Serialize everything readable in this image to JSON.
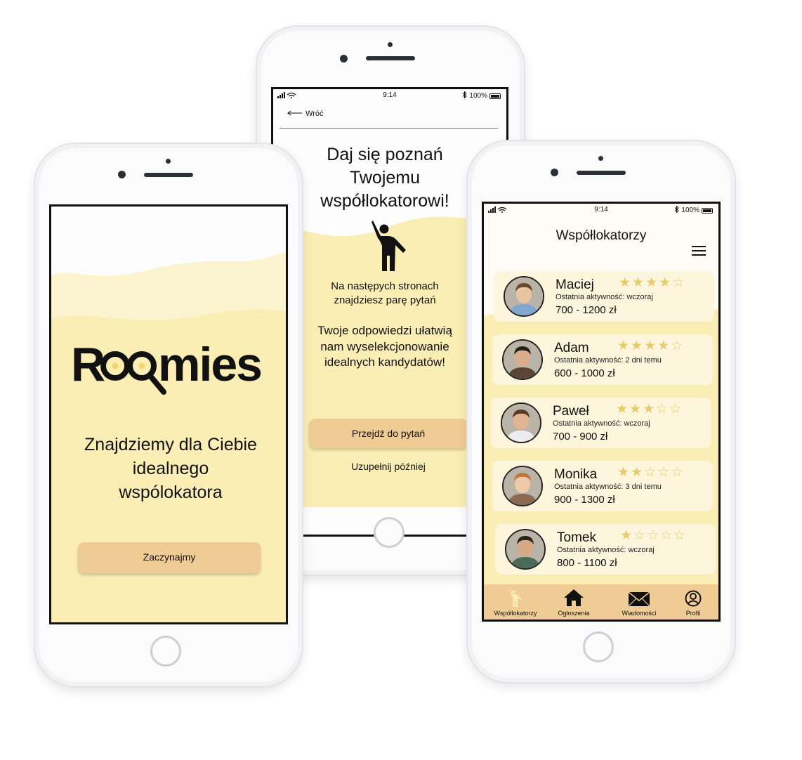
{
  "welcome": {
    "logo_text": "Roomies",
    "tagline": "Znajdziemy dla Ciebie idealnego wspólokatora",
    "start_button": "Zaczynajmy"
  },
  "questions": {
    "status": {
      "time": "9:14",
      "battery": "100%"
    },
    "back_label": "Wróć",
    "title": "Daj się poznań Twojemu współlokatorowi!",
    "text1": "Na następych stronach znajdziesz parę pytań",
    "text2": "Twoje odpowiedzi ułatwią nam wyselekcjonowanie idealnych kandydatów!",
    "primary_button": "Przejdź do pytań",
    "secondary_button": "Uzupełnij później"
  },
  "roommates": {
    "status": {
      "time": "9:14",
      "battery": "100%"
    },
    "title": "Współlokatorzy",
    "list": [
      {
        "name": "Maciej",
        "rating": 4,
        "activity": "Ostatnia aktywność: wczoraj",
        "price": "700 - 1200 zł"
      },
      {
        "name": "Adam",
        "rating": 4,
        "activity": "Ostatnia aktywność: 2 dni temu",
        "price": "600 - 1000 zł"
      },
      {
        "name": "Paweł",
        "rating": 3,
        "activity": "Ostatnia aktywność: wczoraj",
        "price": "700 - 900 zł"
      },
      {
        "name": "Monika",
        "rating": 2,
        "activity": "Ostatnia aktywność: 3 dni temu",
        "price": "900 - 1300 zł"
      },
      {
        "name": "Tomek",
        "rating": 1,
        "activity": "Ostatnia aktywność: wczoraj",
        "price": "800 - 1100 zł"
      }
    ],
    "tabs": [
      {
        "label": "Współlokatorzy",
        "icon": "person-waving-icon"
      },
      {
        "label": "Ogłoszenia",
        "icon": "house-icon"
      },
      {
        "label": "Wiadomości",
        "icon": "envelope-icon"
      },
      {
        "label": "Profil",
        "icon": "profile-icon"
      }
    ]
  },
  "colors": {
    "accent": "#f0cc95",
    "background": "#fbeeb5",
    "star": "#e7cc6e"
  }
}
